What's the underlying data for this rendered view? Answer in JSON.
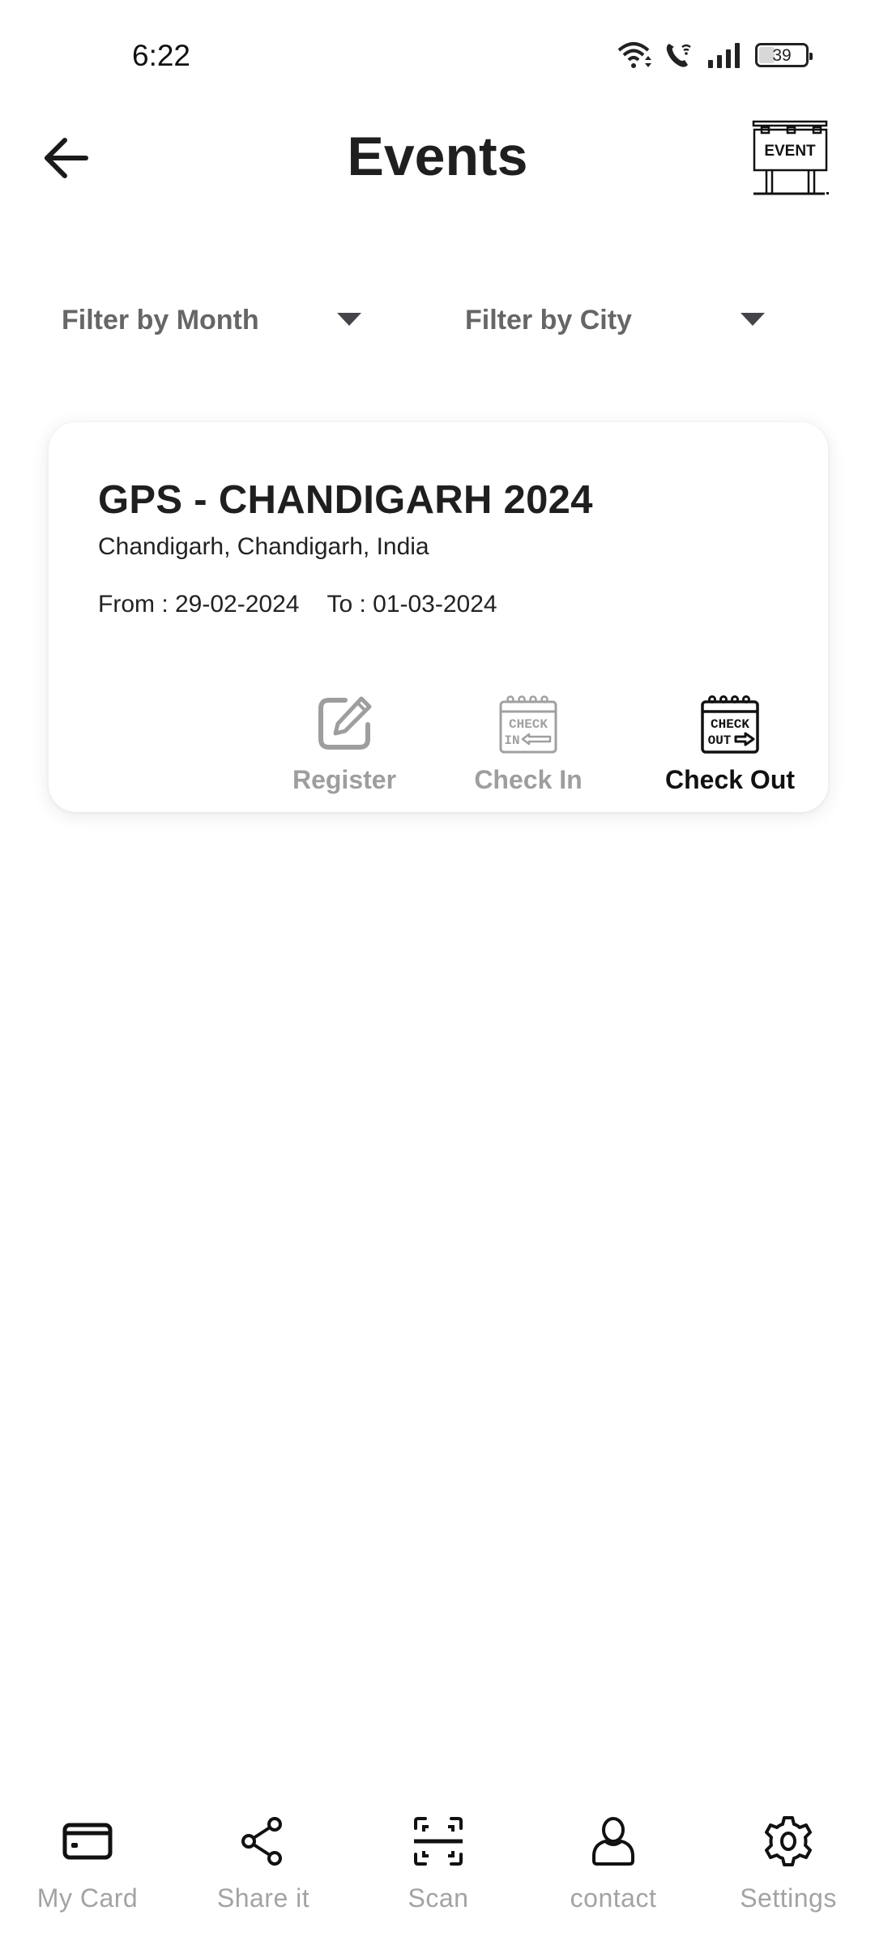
{
  "status_bar": {
    "time": "6:22",
    "battery_level": "39",
    "battery_fraction": 0.39,
    "icons": [
      "wifi-icon",
      "wifi-call-icon",
      "signal-icon",
      "battery-icon"
    ]
  },
  "header": {
    "title": "Events",
    "back_icon": "arrow-left-icon",
    "logo_text": "EVENT"
  },
  "filters": {
    "month": {
      "label": "Filter by Month",
      "icon": "caret-down-icon"
    },
    "city": {
      "label": "Filter by City",
      "icon": "caret-down-icon"
    }
  },
  "events": [
    {
      "title": "GPS - CHANDIGARH 2024",
      "location": "Chandigarh, Chandigarh, India",
      "from_label": "From : 29-02-2024",
      "to_label": "To : 01-03-2024",
      "actions": [
        {
          "label": "Register",
          "icon": "edit-icon",
          "state": "disabled"
        },
        {
          "label": "Check In",
          "icon": "check-in-calendar-icon",
          "state": "disabled",
          "icon_text_top": "CHECK",
          "icon_text_bottom": "IN"
        },
        {
          "label": "Check Out",
          "icon": "check-out-calendar-icon",
          "state": "active",
          "icon_text_top": "CHECK",
          "icon_text_bottom": "OUT"
        }
      ]
    }
  ],
  "bottom_nav": {
    "items": [
      {
        "label": "My Card",
        "icon": "credit-card-icon"
      },
      {
        "label": "Share it",
        "icon": "share-icon"
      },
      {
        "label": "Scan",
        "icon": "scan-icon"
      },
      {
        "label": "contact",
        "icon": "user-icon"
      },
      {
        "label": "Settings",
        "icon": "gear-icon"
      }
    ]
  },
  "colors": {
    "text_primary": "#1f1f1f",
    "text_muted": "#9e9e9e",
    "filter_text": "#666666",
    "nav_label": "#a3a3a3",
    "background": "#ffffff"
  }
}
